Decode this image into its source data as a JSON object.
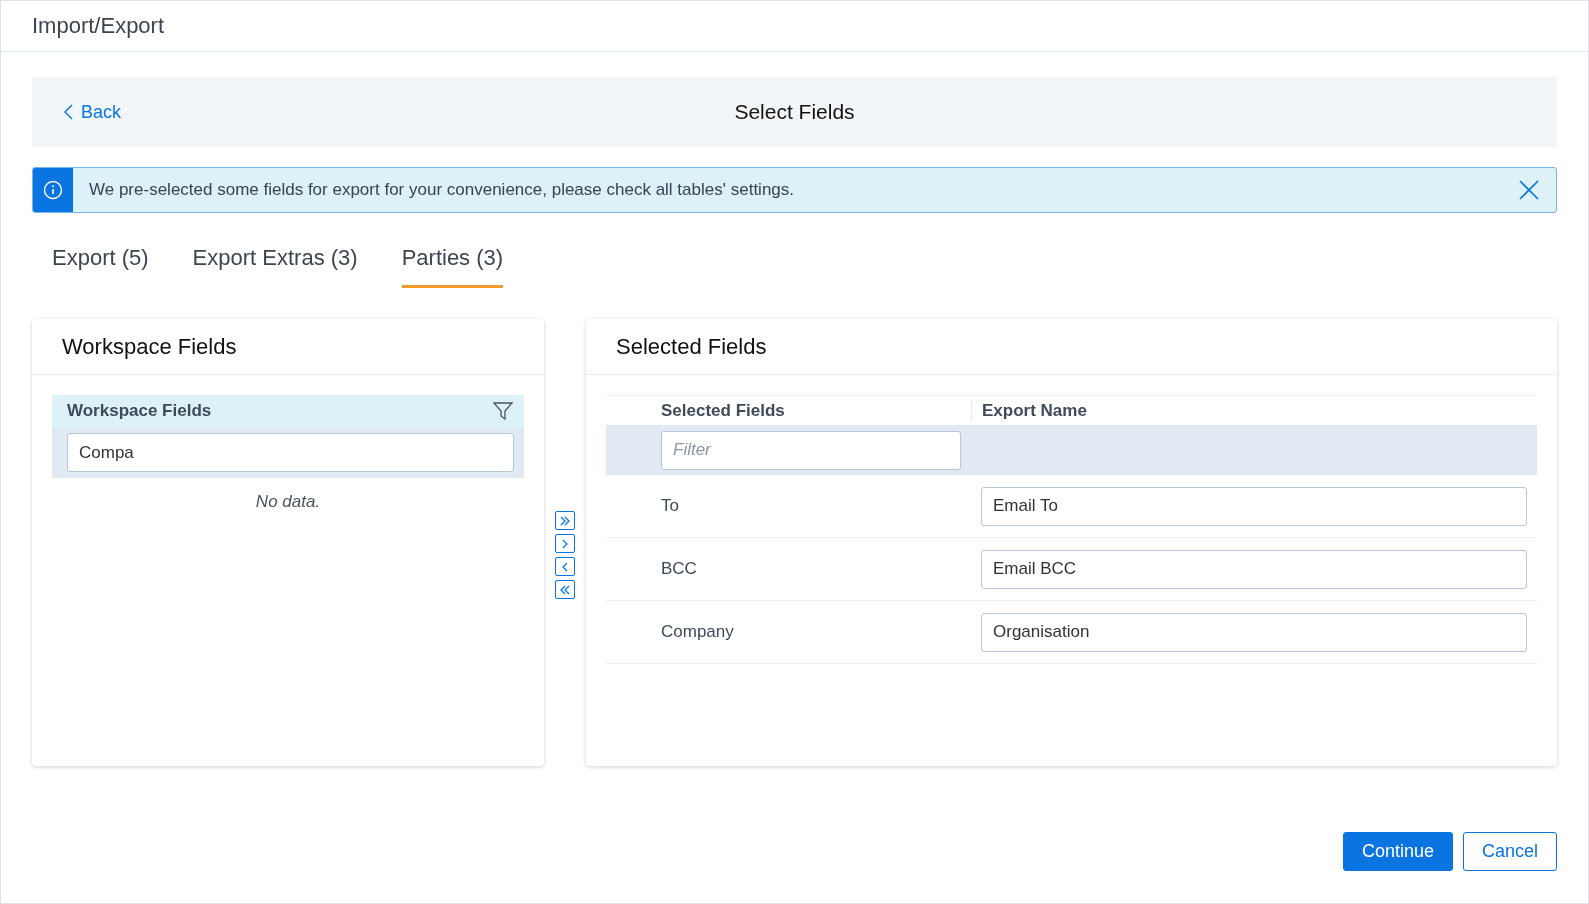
{
  "window": {
    "title": "Import/Export"
  },
  "header": {
    "back": "Back",
    "title": "Select Fields"
  },
  "alert": {
    "message": "We pre-selected some fields for export for your convenience, please check all tables' settings."
  },
  "tabs": [
    {
      "label": "Export (5)",
      "selected": false
    },
    {
      "label": "Export Extras (3)",
      "selected": false
    },
    {
      "label": "Parties (3)",
      "selected": true
    }
  ],
  "workspace_panel": {
    "title": "Workspace Fields",
    "column": "Workspace Fields",
    "filter_value": "Compa",
    "empty": "No data."
  },
  "selected_panel": {
    "title": "Selected Fields",
    "columns": [
      "Selected Fields",
      "Export Name"
    ],
    "filter_placeholder": "Filter",
    "rows": [
      {
        "field": "To",
        "export_name": "Email To"
      },
      {
        "field": "BCC",
        "export_name": "Email BCC"
      },
      {
        "field": "Company",
        "export_name": "Organisation"
      }
    ]
  },
  "buttons": [
    {
      "label": "Continue",
      "kind": "primary"
    },
    {
      "label": "Cancel",
      "kind": "secondary"
    }
  ]
}
